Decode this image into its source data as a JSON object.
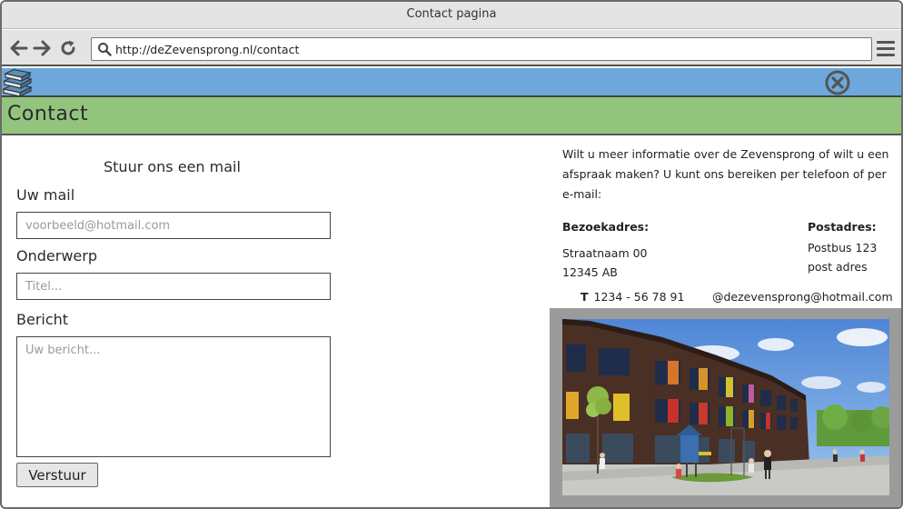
{
  "window": {
    "title": "Contact pagina"
  },
  "browser": {
    "url": "http://deZevensprong.nl/contact"
  },
  "page": {
    "title": "Contact"
  },
  "form": {
    "heading": "Stuur ons een mail",
    "email_label": "Uw mail",
    "email_placeholder": "voorbeeld@hotmail.com",
    "subject_label": "Onderwerp",
    "subject_placeholder": "Titel...",
    "message_label": "Bericht",
    "message_placeholder": "Uw bericht...",
    "submit_label": "Verstuur"
  },
  "info": {
    "intro": "Wilt u meer informatie over de Zevensprong of wilt u een afspraak maken? U kunt ons bereiken per telefoon of per e-mail:",
    "visit_heading": "Bezoekadres:",
    "visit_line1": "Straatnaam 00",
    "visit_line2": "12345 AB",
    "postal_heading": "Postadres:",
    "postal_line1": "Postbus 123",
    "postal_line2": "post adres",
    "phone_prefix": "T",
    "phone": "1234 - 56 78 91",
    "email": "@dezevensprong@hotmail.com"
  },
  "icons": {
    "back": "arrow-left-icon",
    "forward": "arrow-right-icon",
    "refresh": "refresh-icon",
    "search": "search-icon",
    "menu": "hamburger-menu-icon",
    "logo": "books-stack-icon",
    "close": "close-circle-icon"
  },
  "colors": {
    "header_blue": "#6da7dc",
    "title_green": "#92c47e",
    "photo_frame": "#9b9b9b"
  }
}
